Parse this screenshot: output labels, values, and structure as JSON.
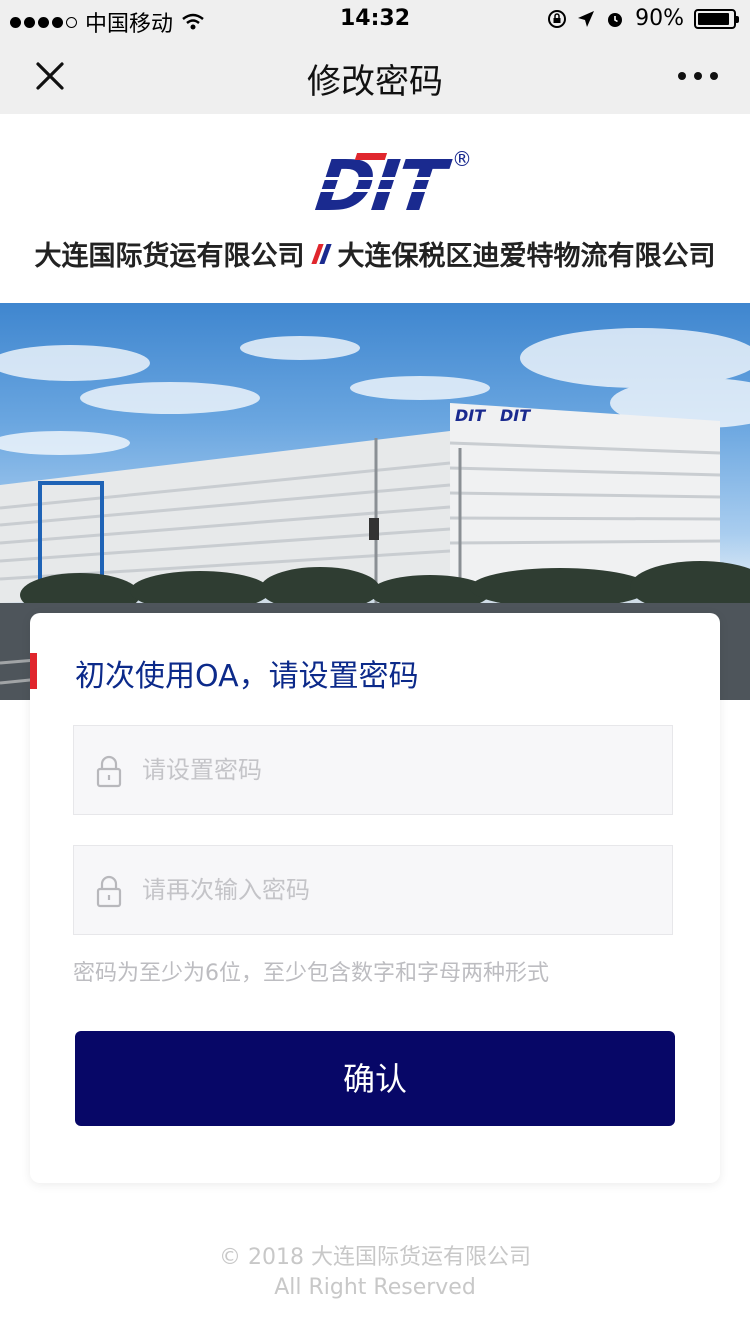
{
  "status_bar": {
    "carrier": "中国移动",
    "time": "14:32",
    "battery": "90%",
    "battery_level": 0.9
  },
  "nav": {
    "title": "修改密码",
    "close_icon": "close-icon",
    "more_icon": "more-icon"
  },
  "brand": {
    "logo_text": "DIT",
    "registered_mark": "®",
    "company_a": "大连国际货运有限公司",
    "company_b": "大连保税区迪爱特物流有限公司",
    "colors": {
      "brand_blue": "#1a2a8f",
      "brand_red": "#e0262d"
    }
  },
  "hero": {
    "building_signs": [
      "DIT",
      "DIT"
    ]
  },
  "form": {
    "heading": "初次使用OA，请设置密码",
    "password_placeholder": "请设置密码",
    "password_confirm_placeholder": "请再次输入密码",
    "hint": "密码为至少为6位，至少包含数字和字母两种形式",
    "confirm_label": "确认",
    "colors": {
      "button": "#070767",
      "heading": "#0c2a8a",
      "accent": "#e0262d"
    }
  },
  "footer": {
    "copyright": "© 2018 大连国际货运有限公司",
    "rights": "All Right Reserved"
  }
}
